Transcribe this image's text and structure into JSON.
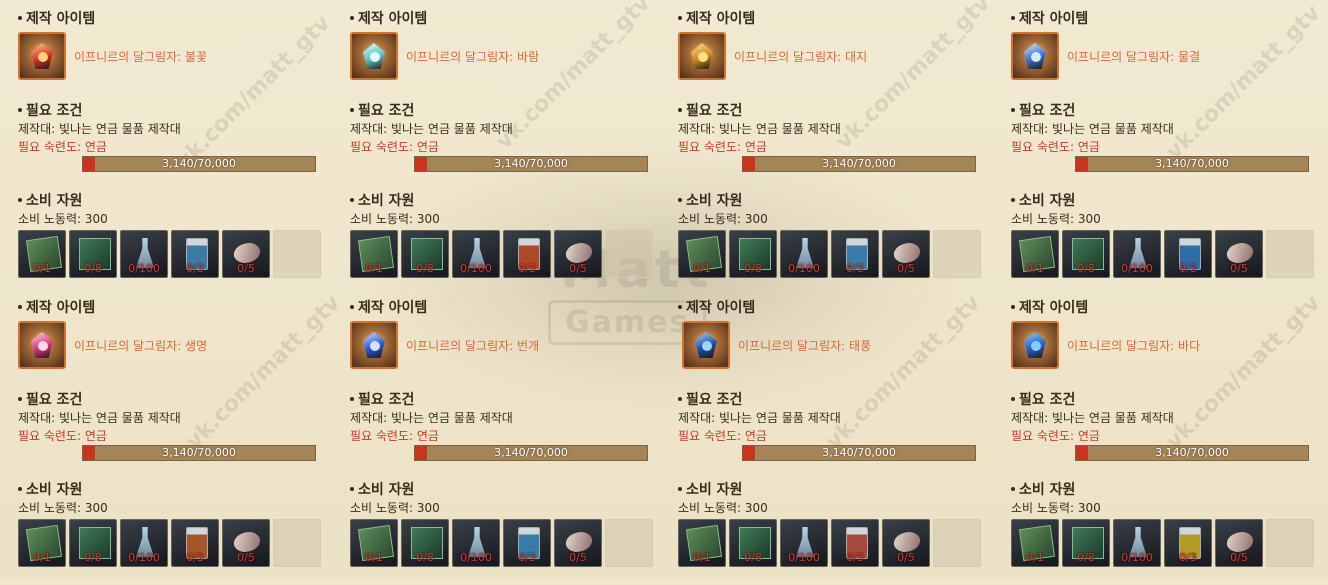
{
  "labels": {
    "craft_item": "제작 아이템",
    "requirements": "필요 조건",
    "workbench": "제작대: 빛나는 연금 물품 제작대",
    "proficiency": "필요 숙련도: 연금",
    "resources": "소비 자원",
    "labor": "소비 노동력: 300"
  },
  "progress": {
    "text": "3,140/70,000",
    "current": 3140,
    "max": 70000
  },
  "resource_slots": [
    {
      "icon": "recipe-scroll-icon",
      "count": "0/1"
    },
    {
      "icon": "green-tome-icon",
      "count": "0/8"
    },
    {
      "icon": "empty-flask-icon",
      "count": "0/100"
    },
    {
      "icon": "potion-bottle-icon",
      "count": "0/3"
    },
    {
      "icon": "feather-icon",
      "count": "0/5"
    }
  ],
  "potion_colors": [
    "#3a7ca8",
    "#b04a26",
    "#3a7ca8",
    "#2f6ea8",
    "#a8552a",
    "#3a7ca8",
    "#a84a3a",
    "#b49a26"
  ],
  "panels": [
    {
      "item_name": "이프니르의 달그림자: 불꽃",
      "gem_color": "#d6322a",
      "core_color": "#ffd27a",
      "gem_icon": "fire-gem-icon"
    },
    {
      "item_name": "이프니르의 달그림자: 바람",
      "gem_color": "#5fc2c2",
      "core_color": "#e6fbff",
      "gem_icon": "wind-gem-icon"
    },
    {
      "item_name": "이프니르의 달그림자: 대지",
      "gem_color": "#c98a22",
      "core_color": "#ffe08a",
      "gem_icon": "earth-gem-icon"
    },
    {
      "item_name": "이프니르의 달그림자: 물결",
      "gem_color": "#3d6fd0",
      "core_color": "#d8ecff",
      "gem_icon": "water-gem-icon"
    },
    {
      "item_name": "이프니르의 달그림자: 생명",
      "gem_color": "#d83a7a",
      "core_color": "#ffd6ea",
      "gem_icon": "life-gem-icon"
    },
    {
      "item_name": "이프니르의 달그림자: 번개",
      "gem_color": "#2a5ad0",
      "core_color": "#cfe2ff",
      "gem_icon": "lightning-gem-icon"
    },
    {
      "item_name": "이프니르의 달그림자: 태풍",
      "gem_color": "#1e4fa0",
      "core_color": "#9fd4ff",
      "gem_icon": "storm-gem-icon"
    },
    {
      "item_name": "이프니르의 달그림자: 바다",
      "gem_color": "#2e5fc8",
      "core_color": "#7fd0ff",
      "gem_icon": "sea-gem-icon"
    }
  ],
  "watermark": {
    "url": "vk.com/matt_gtv",
    "brand": "Matt",
    "brand_sub": "Games"
  }
}
